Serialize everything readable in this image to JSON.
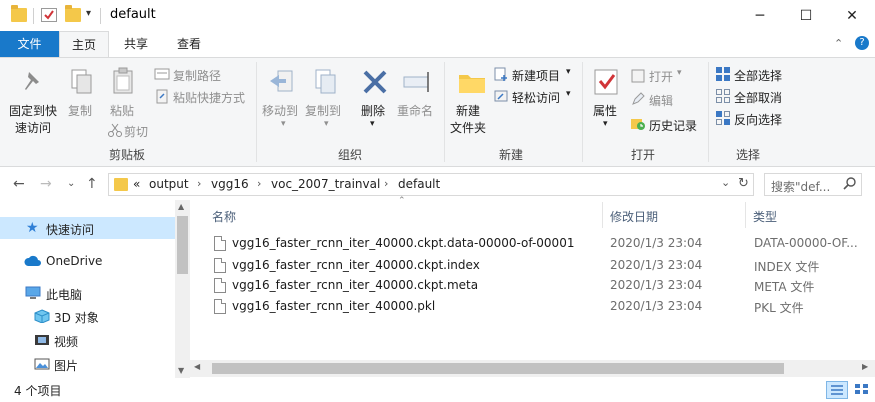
{
  "window": {
    "title": "default",
    "minimize": "─",
    "maximize": "☐",
    "close": "✕"
  },
  "tabs": [
    {
      "label": "文件"
    },
    {
      "label": "主页"
    },
    {
      "label": "共享"
    },
    {
      "label": "查看"
    }
  ],
  "ribbon": {
    "clipboard": {
      "group_label": "剪贴板",
      "pin_label_1": "固定到快",
      "pin_label_2": "速访问",
      "copy": "复制",
      "paste": "粘贴",
      "copy_path": "复制路径",
      "paste_shortcut": "粘贴快捷方式",
      "cut": "剪切"
    },
    "organize": {
      "group_label": "组织",
      "move_to": "移动到",
      "copy_to": "复制到",
      "delete": "删除",
      "rename": "重命名"
    },
    "new": {
      "group_label": "新建",
      "new_folder_1": "新建",
      "new_folder_2": "文件夹",
      "new_item": "新建项目",
      "easy_access": "轻松访问"
    },
    "open": {
      "group_label": "打开",
      "properties": "属性",
      "open": "打开",
      "edit": "编辑",
      "history": "历史记录"
    },
    "select": {
      "group_label": "选择",
      "select_all": "全部选择",
      "select_none": "全部取消",
      "invert": "反向选择"
    }
  },
  "address": {
    "crumbs": [
      "output",
      "vgg16",
      "voc_2007_trainval",
      "default"
    ],
    "overflow": "«",
    "search_placeholder": "搜索\"def...",
    "refresh": "↻",
    "dropdown": "⌄"
  },
  "nav": {
    "items": [
      {
        "label": "快速访问"
      },
      {
        "label": "OneDrive"
      },
      {
        "label": "此电脑"
      },
      {
        "label": "3D 对象"
      },
      {
        "label": "视频"
      },
      {
        "label": "图片"
      }
    ]
  },
  "columns": {
    "name": "名称",
    "date": "修改日期",
    "type": "类型"
  },
  "files": [
    {
      "name": "vgg16_faster_rcnn_iter_40000.ckpt.data-00000-of-00001",
      "date": "2020/1/3 23:04",
      "type": "DATA-00000-OF..."
    },
    {
      "name": "vgg16_faster_rcnn_iter_40000.ckpt.index",
      "date": "2020/1/3 23:04",
      "type": "INDEX 文件"
    },
    {
      "name": "vgg16_faster_rcnn_iter_40000.ckpt.meta",
      "date": "2020/1/3 23:04",
      "type": "META 文件"
    },
    {
      "name": "vgg16_faster_rcnn_iter_40000.pkl",
      "date": "2020/1/3 23:04",
      "type": "PKL 文件"
    }
  ],
  "status": {
    "count": "4 个项目"
  },
  "colors": {
    "accent": "#1979ca",
    "selected": "#cce8ff",
    "folder": "#f4c84a"
  }
}
